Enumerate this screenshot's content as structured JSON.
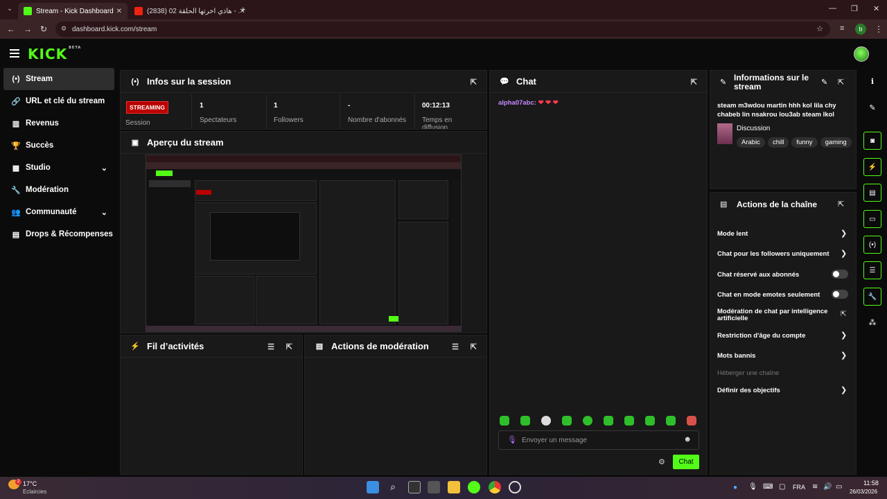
{
  "browser": {
    "tabs": [
      {
        "title": "Stream - Kick Dashboard",
        "active": true
      },
      {
        "title": "(2838) هاذي اخرتها الحلقة 02 - ...e",
        "active": false
      }
    ],
    "url": "dashboard.kick.com/stream"
  },
  "header": {
    "logo": "KICK",
    "logo_beta": "BETA"
  },
  "sidebar": {
    "items": [
      {
        "label": "Stream",
        "icon": "broadcast-icon",
        "glyph": "(•)",
        "active": true
      },
      {
        "label": "URL et clé du stream",
        "icon": "link-icon",
        "glyph": "🔗"
      },
      {
        "label": "Revenus",
        "icon": "chart-icon",
        "glyph": "▥"
      },
      {
        "label": "Succès",
        "icon": "trophy-icon",
        "glyph": "🏆"
      },
      {
        "label": "Studio",
        "icon": "studio-icon",
        "glyph": "▦",
        "expandable": true
      },
      {
        "label": "Modération",
        "icon": "wrench-icon",
        "glyph": "🔧"
      },
      {
        "label": "Communauté",
        "icon": "community-icon",
        "glyph": "👥",
        "expandable": true
      },
      {
        "label": "Drops & Récompenses",
        "icon": "drops-icon",
        "glyph": "▤"
      }
    ]
  },
  "session": {
    "title": "Infos sur la session",
    "status": "STREAMING",
    "session_label": "Session",
    "stats": [
      {
        "value": "1",
        "label": "Spectateurs"
      },
      {
        "value": "1",
        "label": "Followers"
      },
      {
        "value": "-",
        "label": "Nombre d'abonnés"
      },
      {
        "value": "00:12:13",
        "label": "Temps en diffusion"
      }
    ]
  },
  "preview": {
    "title": "Aperçu du stream"
  },
  "activity": {
    "title": "Fil d’activités"
  },
  "moderation": {
    "title": "Actions de modération"
  },
  "chat": {
    "title": "Chat",
    "messages": [
      {
        "user": "alpha07abc:",
        "text": "❤ ❤ ❤",
        "user_color": "#c58cff"
      }
    ],
    "placeholder": "Envoyer un message",
    "send_label": "Chat"
  },
  "stream_info": {
    "title": "Informations sur le stream",
    "stream_title": "steam m3wdou martin hhh kol lila chy chabeb lin nsakrou lou3ab steam lkol",
    "category": "Discussion",
    "tags": [
      "Arabic",
      "chill",
      "funny",
      "gaming"
    ]
  },
  "channel_actions": {
    "title": "Actions de la chaîne",
    "items": [
      {
        "label": "Mode lent",
        "control": "chevron"
      },
      {
        "label": "Chat pour les followers uniquement",
        "control": "chevron"
      },
      {
        "label": "Chat réservé aux abonnés",
        "control": "toggle",
        "on": false
      },
      {
        "label": "Chat en mode emotes seulement",
        "control": "toggle",
        "on": false
      },
      {
        "label": "Modération de chat par intelligence artificielle",
        "control": "external"
      },
      {
        "label": "Restriction d'âge du compte",
        "control": "chevron"
      },
      {
        "label": "Mots bannis",
        "control": "chevron"
      },
      {
        "label": "Héberger une chaîne",
        "control": "none",
        "disabled": true
      },
      {
        "label": "Définir des objectifs",
        "control": "chevron"
      }
    ]
  },
  "taskbar": {
    "weather_temp": "17°C",
    "weather_desc": "Eclaircies",
    "weather_badge": "2",
    "lang": "FRA",
    "time": "11:58",
    "date": "26/03/2026"
  },
  "colors": {
    "accent": "#53fc18",
    "streaming": "#bb0000",
    "panel": "#191919"
  }
}
